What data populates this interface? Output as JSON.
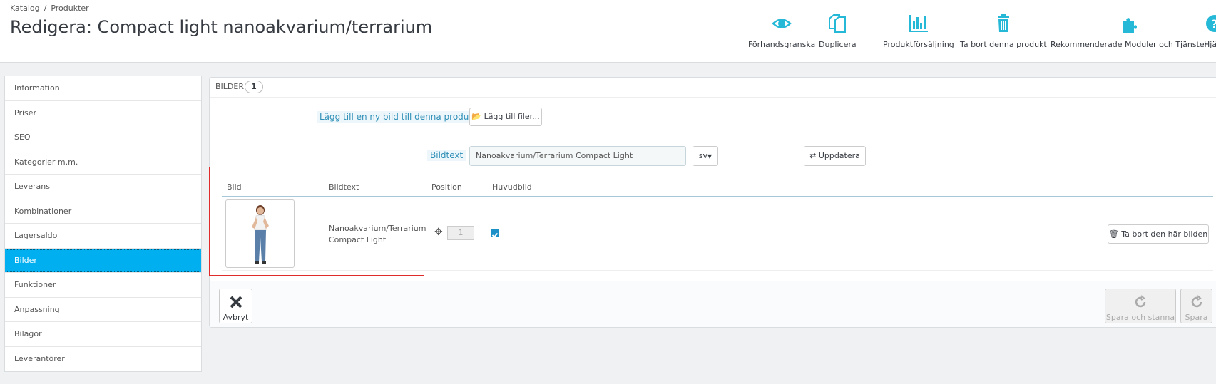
{
  "breadcrumb": {
    "item1": "Katalog",
    "separator": "/",
    "item2": "Produkter"
  },
  "page": {
    "title": "Redigera: Compact light nanoakvarium/terrarium"
  },
  "toolbar": {
    "preview": "Förhandsgranska",
    "duplicate": "Duplicera",
    "sales": "Produktförsäljning",
    "delete": "Ta bort denna produkt",
    "modules": "Rekommenderade Moduler och Tjänster",
    "help": "Hjä"
  },
  "tabs": [
    {
      "label": "Information"
    },
    {
      "label": "Priser"
    },
    {
      "label": "SEO"
    },
    {
      "label": "Kategorier m.m."
    },
    {
      "label": "Leverans"
    },
    {
      "label": "Kombinationer"
    },
    {
      "label": "Lagersaldo"
    },
    {
      "label": "Bilder"
    },
    {
      "label": "Funktioner"
    },
    {
      "label": "Anpassning"
    },
    {
      "label": "Bilagor"
    },
    {
      "label": "Leverantörer"
    }
  ],
  "panel": {
    "title": "BILDER",
    "count": "1",
    "add_label": "Lägg till en ny bild till denna produkt",
    "add_button": "Lägg till filer...",
    "caption_label": "Bildtext",
    "caption_value": "Nanoakvarium/Terrarium Compact Light",
    "lang": "sv",
    "update_button": "Uppdatera"
  },
  "table": {
    "headers": {
      "image": "Bild",
      "caption": "Bildtext",
      "position": "Position",
      "cover": "Huvudbild"
    },
    "row": {
      "caption_line1": "Nanoakvarium/Terrarium",
      "caption_line2": "Compact Light",
      "position": "1",
      "delete_button": "Ta bort den här bilden"
    }
  },
  "footer": {
    "cancel": "Avbryt",
    "save_stay": "Spara och stanna",
    "save": "Spara"
  },
  "colors": {
    "accent": "#00aff0",
    "icon": "#25b9d7",
    "highlight": "#e02b2b"
  }
}
